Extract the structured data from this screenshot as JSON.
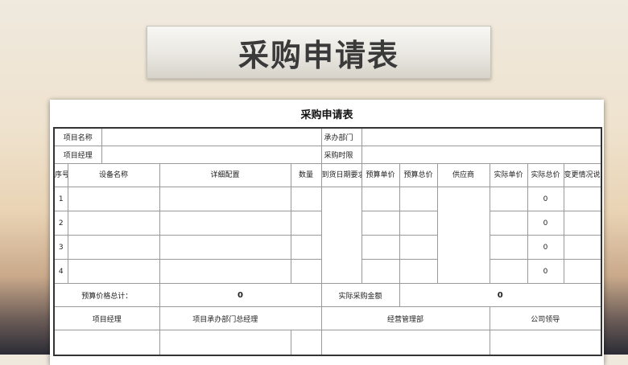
{
  "banner_title": "采购申请表",
  "sheet_title": "采购申请表",
  "info": {
    "project_name_label": "项目名称",
    "undertake_dept_label": "承办部门",
    "project_manager_label": "项目经理",
    "purchase_deadline_label": "采购时限"
  },
  "columns": {
    "seq": "序号",
    "equipment_name": "设备名称",
    "detail_config": "详细配置",
    "quantity": "数量",
    "delivery_date": "到货日期要求",
    "budget_unit_price": "预算单价",
    "budget_total": "预算总价",
    "supplier": "供应商",
    "actual_unit_price": "实际单价",
    "actual_total": "实际总价",
    "change_note": "变更情况说明"
  },
  "rows": [
    {
      "seq": "1",
      "actual_total": "0"
    },
    {
      "seq": "2",
      "actual_total": "0"
    },
    {
      "seq": "3",
      "actual_total": "0"
    },
    {
      "seq": "4",
      "actual_total": "0"
    }
  ],
  "summary": {
    "budget_total_label": "预算价格总计：",
    "budget_total_value": "0",
    "actual_amount_label": "实际采购金额",
    "actual_amount_value": "0"
  },
  "signatures": {
    "project_manager": "项目经理",
    "dept_general_manager": "项目承办部门总经理",
    "operations_dept": "经营管理部",
    "company_leader": "公司领导"
  }
}
